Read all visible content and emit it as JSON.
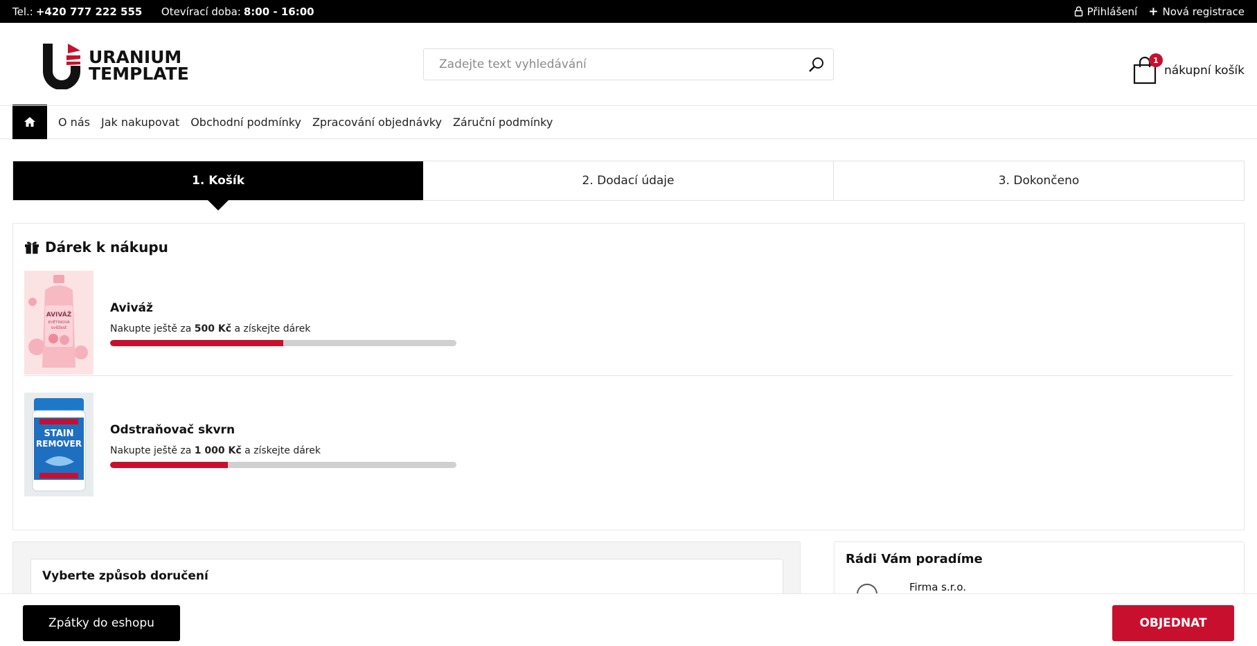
{
  "topbar": {
    "phone_label": "Tel.:",
    "phone": "+420 777 222 555",
    "hours_label": "Otevírací doba:",
    "hours": "8:00 - 16:00",
    "login": "Přihlášení",
    "register": "Nová registrace"
  },
  "header": {
    "logo_line1": "URANIUM",
    "logo_line2": "TEMPLATE",
    "search_placeholder": "Zadejte text vyhledávání",
    "cart_label": "nákupní košík",
    "cart_count": "1"
  },
  "nav": {
    "items": [
      "O nás",
      "Jak nakupovat",
      "Obchodní podmínky",
      "Zpracování objednávky",
      "Záruční podmínky"
    ]
  },
  "steps": [
    "1. Košík",
    "2. Dodací údaje",
    "3. Dokončeno"
  ],
  "gift": {
    "title": "Dárek k nákupu",
    "items": [
      {
        "name": "Aviváž",
        "desc_before": "Nakupte ještě za",
        "amount": "500 Kč",
        "desc_after": "a získejte dárek",
        "progress": 0.5,
        "img_text1": "AVIVÁŽ",
        "img_text2": "KVĚTINOVÁ",
        "img_text3": "svěžest"
      },
      {
        "name": "Odstraňovač skvrn",
        "desc_before": "Nakupte ještě za",
        "amount": "1 000 Kč",
        "desc_after": "a získejte dárek",
        "progress": 0.34,
        "img_text1": "STAIN",
        "img_text2": "REMOVER"
      }
    ]
  },
  "delivery": {
    "title": "Vyberte způsob doručení"
  },
  "help": {
    "title": "Rádi Vám poradíme",
    "company": "Firma s.r.o."
  },
  "footer": {
    "back": "Zpátky do eshopu",
    "order": "OBJEDNAT"
  },
  "colors": {
    "accent": "#c8102e",
    "dark": "#000000"
  }
}
